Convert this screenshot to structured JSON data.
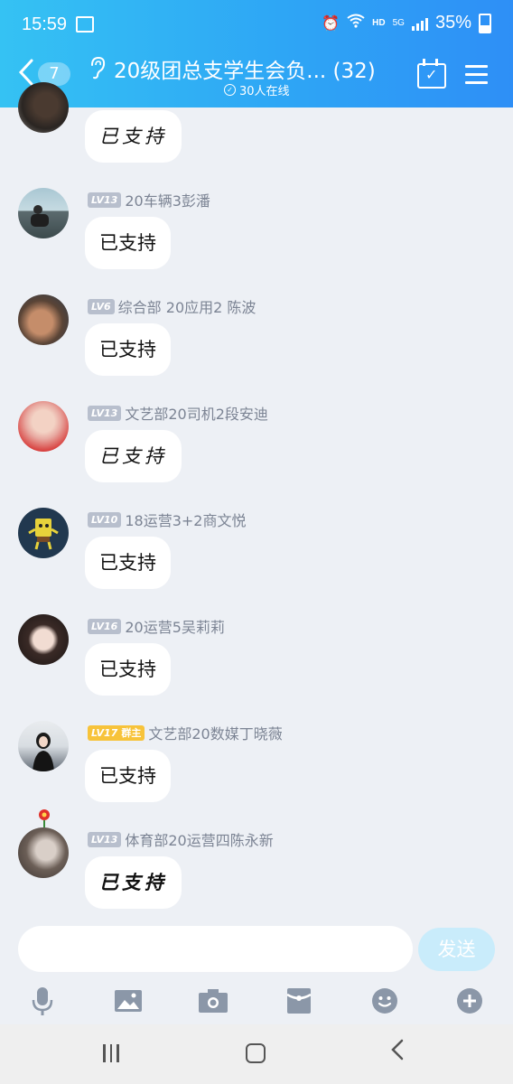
{
  "status_bar": {
    "time": "15:59",
    "hd": "HD",
    "network": "5G",
    "battery": "35%"
  },
  "header": {
    "back_count": "7",
    "title": "20级团总支学生会负... (32)",
    "online": "30人在线"
  },
  "messages": [
    {
      "level": "",
      "sender": "",
      "text": "已支持",
      "style": "handwritten"
    },
    {
      "level": "LV13",
      "sender": "20车辆3彭潘",
      "text": "已支持"
    },
    {
      "level": "LV6",
      "sender": "综合部 20应用2 陈波",
      "text": "已支持"
    },
    {
      "level": "LV13",
      "sender": "文艺部20司机2段安迪",
      "text": "已支持",
      "style": "handwritten"
    },
    {
      "level": "LV10",
      "sender": "18运营3+2商文悦",
      "text": "已支持"
    },
    {
      "level": "LV16",
      "sender": "20运营5吴莉莉",
      "text": "已支持"
    },
    {
      "level": "LV17",
      "role": "群主",
      "sender": "文艺部20数媒丁晓薇",
      "text": "已支持"
    },
    {
      "level": "LV13",
      "sender": "体育部20运营四陈永新",
      "text": "已支持",
      "style": "handwritten"
    }
  ],
  "input": {
    "placeholder": "",
    "send_label": "发送"
  },
  "toolbar": [
    "mic-icon",
    "image-icon",
    "camera-icon",
    "red-packet-icon",
    "emoji-icon",
    "plus-icon"
  ],
  "colors": {
    "header_start": "#35c2f3",
    "header_end": "#2e8ff6",
    "background": "#edf0f5",
    "send_button": "#c9ecfb",
    "owner_badge": "#f7c33a"
  }
}
